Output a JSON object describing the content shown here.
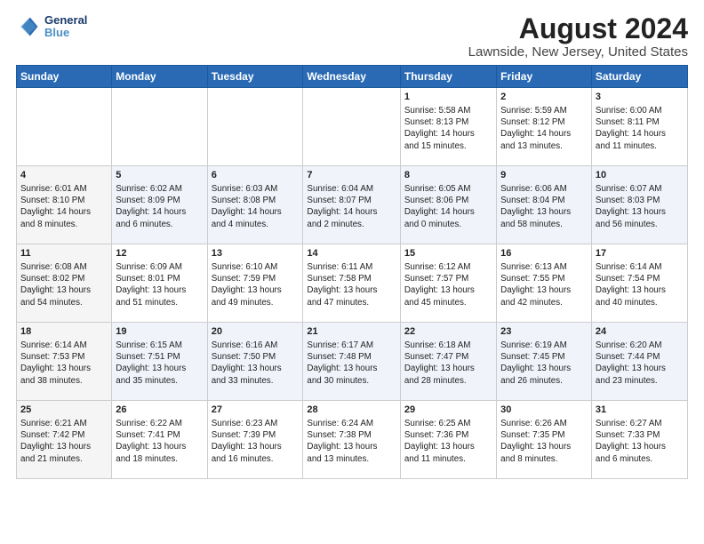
{
  "header": {
    "logo_line1": "General",
    "logo_line2": "Blue",
    "title": "August 2024",
    "subtitle": "Lawnside, New Jersey, United States"
  },
  "weekdays": [
    "Sunday",
    "Monday",
    "Tuesday",
    "Wednesday",
    "Thursday",
    "Friday",
    "Saturday"
  ],
  "weeks": [
    [
      {
        "day": "",
        "info": ""
      },
      {
        "day": "",
        "info": ""
      },
      {
        "day": "",
        "info": ""
      },
      {
        "day": "",
        "info": ""
      },
      {
        "day": "1",
        "info": "Sunrise: 5:58 AM\nSunset: 8:13 PM\nDaylight: 14 hours\nand 15 minutes."
      },
      {
        "day": "2",
        "info": "Sunrise: 5:59 AM\nSunset: 8:12 PM\nDaylight: 14 hours\nand 13 minutes."
      },
      {
        "day": "3",
        "info": "Sunrise: 6:00 AM\nSunset: 8:11 PM\nDaylight: 14 hours\nand 11 minutes."
      }
    ],
    [
      {
        "day": "4",
        "info": "Sunrise: 6:01 AM\nSunset: 8:10 PM\nDaylight: 14 hours\nand 8 minutes."
      },
      {
        "day": "5",
        "info": "Sunrise: 6:02 AM\nSunset: 8:09 PM\nDaylight: 14 hours\nand 6 minutes."
      },
      {
        "day": "6",
        "info": "Sunrise: 6:03 AM\nSunset: 8:08 PM\nDaylight: 14 hours\nand 4 minutes."
      },
      {
        "day": "7",
        "info": "Sunrise: 6:04 AM\nSunset: 8:07 PM\nDaylight: 14 hours\nand 2 minutes."
      },
      {
        "day": "8",
        "info": "Sunrise: 6:05 AM\nSunset: 8:06 PM\nDaylight: 14 hours\nand 0 minutes."
      },
      {
        "day": "9",
        "info": "Sunrise: 6:06 AM\nSunset: 8:04 PM\nDaylight: 13 hours\nand 58 minutes."
      },
      {
        "day": "10",
        "info": "Sunrise: 6:07 AM\nSunset: 8:03 PM\nDaylight: 13 hours\nand 56 minutes."
      }
    ],
    [
      {
        "day": "11",
        "info": "Sunrise: 6:08 AM\nSunset: 8:02 PM\nDaylight: 13 hours\nand 54 minutes."
      },
      {
        "day": "12",
        "info": "Sunrise: 6:09 AM\nSunset: 8:01 PM\nDaylight: 13 hours\nand 51 minutes."
      },
      {
        "day": "13",
        "info": "Sunrise: 6:10 AM\nSunset: 7:59 PM\nDaylight: 13 hours\nand 49 minutes."
      },
      {
        "day": "14",
        "info": "Sunrise: 6:11 AM\nSunset: 7:58 PM\nDaylight: 13 hours\nand 47 minutes."
      },
      {
        "day": "15",
        "info": "Sunrise: 6:12 AM\nSunset: 7:57 PM\nDaylight: 13 hours\nand 45 minutes."
      },
      {
        "day": "16",
        "info": "Sunrise: 6:13 AM\nSunset: 7:55 PM\nDaylight: 13 hours\nand 42 minutes."
      },
      {
        "day": "17",
        "info": "Sunrise: 6:14 AM\nSunset: 7:54 PM\nDaylight: 13 hours\nand 40 minutes."
      }
    ],
    [
      {
        "day": "18",
        "info": "Sunrise: 6:14 AM\nSunset: 7:53 PM\nDaylight: 13 hours\nand 38 minutes."
      },
      {
        "day": "19",
        "info": "Sunrise: 6:15 AM\nSunset: 7:51 PM\nDaylight: 13 hours\nand 35 minutes."
      },
      {
        "day": "20",
        "info": "Sunrise: 6:16 AM\nSunset: 7:50 PM\nDaylight: 13 hours\nand 33 minutes."
      },
      {
        "day": "21",
        "info": "Sunrise: 6:17 AM\nSunset: 7:48 PM\nDaylight: 13 hours\nand 30 minutes."
      },
      {
        "day": "22",
        "info": "Sunrise: 6:18 AM\nSunset: 7:47 PM\nDaylight: 13 hours\nand 28 minutes."
      },
      {
        "day": "23",
        "info": "Sunrise: 6:19 AM\nSunset: 7:45 PM\nDaylight: 13 hours\nand 26 minutes."
      },
      {
        "day": "24",
        "info": "Sunrise: 6:20 AM\nSunset: 7:44 PM\nDaylight: 13 hours\nand 23 minutes."
      }
    ],
    [
      {
        "day": "25",
        "info": "Sunrise: 6:21 AM\nSunset: 7:42 PM\nDaylight: 13 hours\nand 21 minutes."
      },
      {
        "day": "26",
        "info": "Sunrise: 6:22 AM\nSunset: 7:41 PM\nDaylight: 13 hours\nand 18 minutes."
      },
      {
        "day": "27",
        "info": "Sunrise: 6:23 AM\nSunset: 7:39 PM\nDaylight: 13 hours\nand 16 minutes."
      },
      {
        "day": "28",
        "info": "Sunrise: 6:24 AM\nSunset: 7:38 PM\nDaylight: 13 hours\nand 13 minutes."
      },
      {
        "day": "29",
        "info": "Sunrise: 6:25 AM\nSunset: 7:36 PM\nDaylight: 13 hours\nand 11 minutes."
      },
      {
        "day": "30",
        "info": "Sunrise: 6:26 AM\nSunset: 7:35 PM\nDaylight: 13 hours\nand 8 minutes."
      },
      {
        "day": "31",
        "info": "Sunrise: 6:27 AM\nSunset: 7:33 PM\nDaylight: 13 hours\nand 6 minutes."
      }
    ]
  ]
}
